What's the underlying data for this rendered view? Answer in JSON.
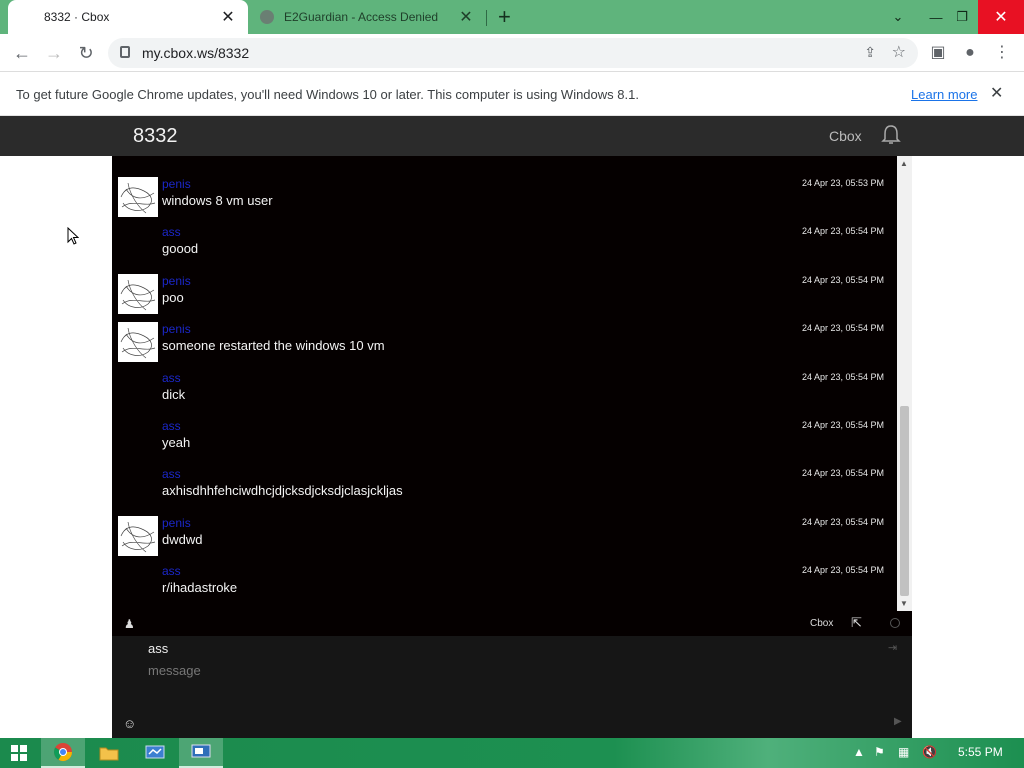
{
  "browser": {
    "tabs": [
      {
        "title": "8332 · Cbox"
      },
      {
        "title": "E2Guardian - Access Denied"
      }
    ],
    "url": "my.cbox.ws/8332"
  },
  "infobar": {
    "message": "To get future Google Chrome updates, you'll need Windows 10 or later. This computer is using Windows 8.1.",
    "link": "Learn more"
  },
  "site": {
    "box_name": "8332",
    "brand": "Cbox"
  },
  "messages": [
    {
      "user": "penis",
      "text": "windows 8 vm user",
      "time": "24 Apr 23, 05:53 PM",
      "avatar": true
    },
    {
      "user": "ass",
      "text": "goood",
      "time": "24 Apr 23, 05:54 PM",
      "avatar": false
    },
    {
      "user": "penis",
      "text": "poo",
      "time": "24 Apr 23, 05:54 PM",
      "avatar": true
    },
    {
      "user": "penis",
      "text": "someone restarted the windows 10 vm",
      "time": "24 Apr 23, 05:54 PM",
      "avatar": true
    },
    {
      "user": "ass",
      "text": "dick",
      "time": "24 Apr 23, 05:54 PM",
      "avatar": false
    },
    {
      "user": "ass",
      "text": "yeah",
      "time": "24 Apr 23, 05:54 PM",
      "avatar": false
    },
    {
      "user": "ass",
      "text": "axhisdhhfehciwdhcjdjcksdjcksdjclasjckljas",
      "time": "24 Apr 23, 05:54 PM",
      "avatar": false
    },
    {
      "user": "penis",
      "text": "dwdwd",
      "time": "24 Apr 23, 05:54 PM",
      "avatar": true
    },
    {
      "user": "ass",
      "text": "r/ihadastroke",
      "time": "24 Apr 23, 05:54 PM",
      "avatar": false
    }
  ],
  "chat_footer": {
    "brand": "Cbox"
  },
  "form": {
    "name_value": "ass",
    "message_placeholder": "message"
  },
  "taskbar": {
    "clock": "5:55 PM"
  },
  "colors": {
    "tab_bar": "#5fb47c",
    "chat_bg": "#050000",
    "username": "#1b27c8",
    "taskbar": "#1d9051"
  }
}
